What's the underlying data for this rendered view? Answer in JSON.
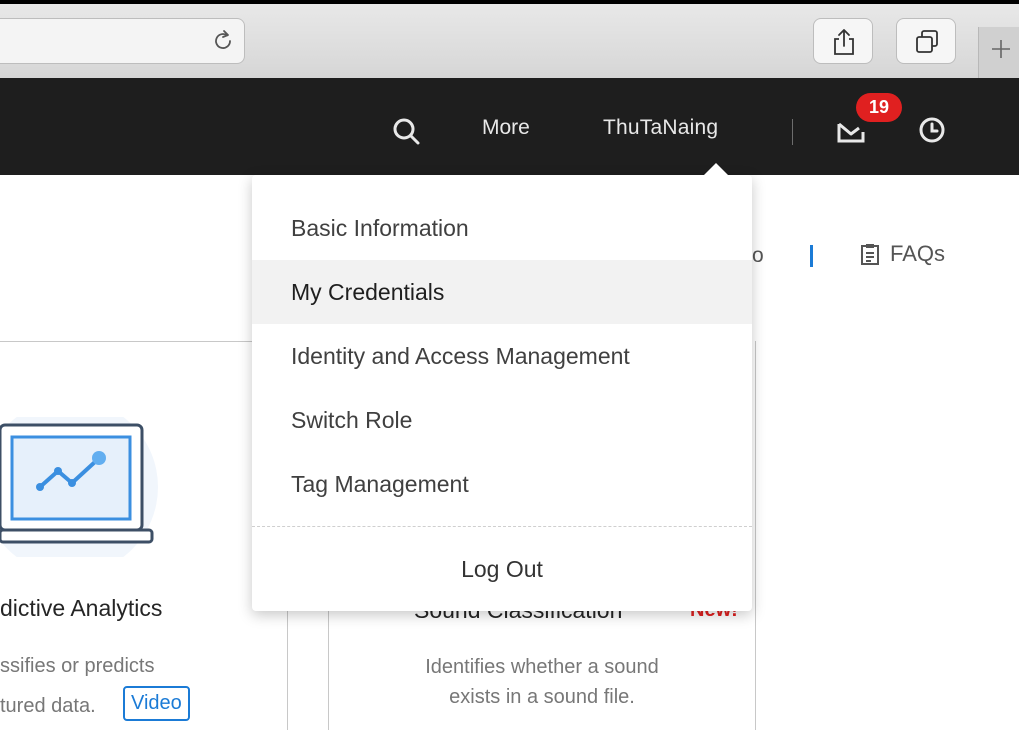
{
  "header": {
    "more_label": "More",
    "username": "ThuTaNaing",
    "notification_count": "19"
  },
  "page": {
    "help_fragment": "o",
    "faqs_label": "FAQs",
    "cards": [
      {
        "title": "dictive Analytics",
        "description_line1": "ssifies or predicts",
        "description_line2": "tured data.",
        "video_label": "Video"
      },
      {
        "title": "Sound Classification",
        "new_label": "New!",
        "description_line1": "Identifies whether a sound",
        "description_line2": "exists in a sound file."
      }
    ]
  },
  "user_menu": {
    "items": [
      {
        "label": "Basic Information"
      },
      {
        "label": "My Credentials"
      },
      {
        "label": "Identity and Access Management"
      },
      {
        "label": "Switch Role"
      },
      {
        "label": "Tag Management"
      }
    ],
    "logout_label": "Log Out",
    "highlighted_item": "My Credentials"
  },
  "colors": {
    "header_background": "#1e1e1e",
    "badge_red": "#e02020",
    "link_blue": "#1b7bd6",
    "menu_hover": "#f2f2f2"
  },
  "icons": [
    "reload-icon",
    "share-icon",
    "tabs-icon",
    "plus-icon",
    "search-icon",
    "mail-icon",
    "clock-icon",
    "faq-document-icon",
    "analytics-laptop-icon"
  ]
}
